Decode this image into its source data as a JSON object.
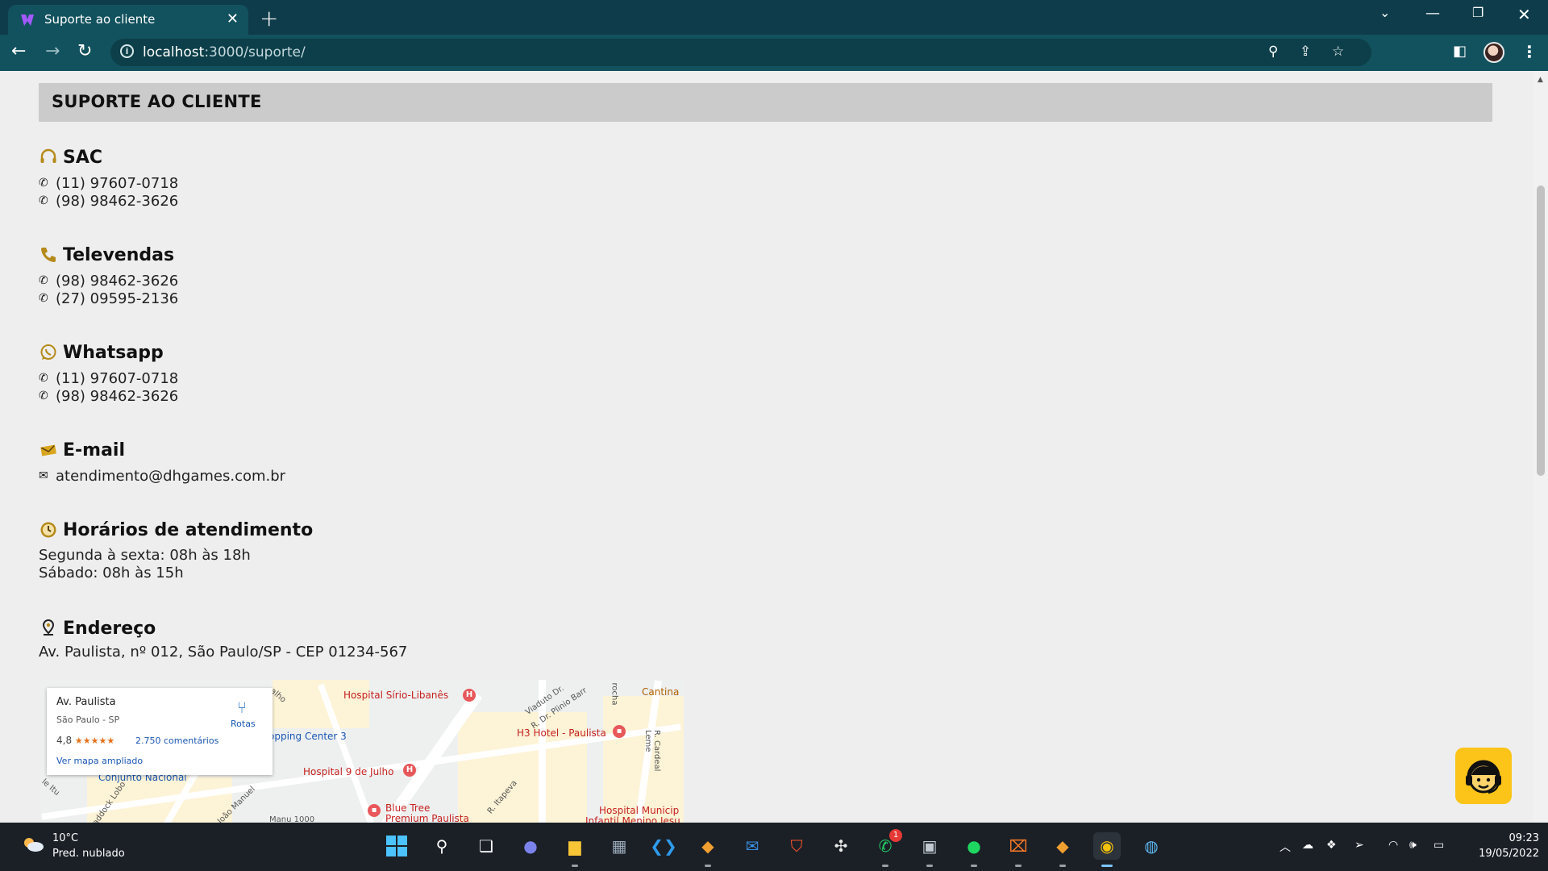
{
  "browser": {
    "tab_title": "Suporte ao cliente",
    "url_host": "localhost",
    "url_path": ":3000/suporte/",
    "accent": "#12525e",
    "frame": "#0f3c4a"
  },
  "page": {
    "header_title": "SUPORTE AO CLIENTE",
    "header_bg": "#cbcbcb",
    "sections": {
      "sac": {
        "title": "SAC",
        "icon": "headset-icon",
        "phones": [
          "(11) 97607-0718",
          "(98) 98462-3626"
        ]
      },
      "televendas": {
        "title": "Televendas",
        "icon": "phone-icon",
        "phones": [
          "(98) 98462-3626",
          "(27) 09595-2136"
        ]
      },
      "whatsapp": {
        "title": "Whatsapp",
        "icon": "whatsapp-icon",
        "phones": [
          "(11) 97607-0718",
          "(98) 98462-3626"
        ]
      },
      "email": {
        "title": "E-mail",
        "icon": "envelope-icon",
        "address": "atendimento@dhgames.com.br"
      },
      "horarios": {
        "title": "Horários de atendimento",
        "icon": "clock-icon",
        "lines": [
          "Segunda à sexta: 08h às 18h",
          "Sábado: 08h às 15h"
        ]
      },
      "endereco": {
        "title": "Endereço",
        "icon": "location-pin-icon",
        "address": "Av. Paulista, nº 012, São Paulo/SP - CEP 01234-567"
      }
    },
    "map": {
      "place_name": "Av. Paulista",
      "place_sub": "São Paulo - SP",
      "rating": "4,8",
      "stars": "★★★★★",
      "reviews": "2.750 comentários",
      "bigger_map": "Ver mapa ampliado",
      "routes": "Rotas",
      "labels": {
        "hospital_sirio": "Hospital Sírio-Libanês",
        "shopping": "opping Center 3",
        "h3_hotel": "H3 Hotel - Paulista",
        "hospital_9": "Hospital 9 de Julho",
        "conjunto": "Conjunto Nacional",
        "blue_tree": "Blue Tree",
        "blue_tree_2": "Premium Paulista",
        "cantina": "Cantina",
        "hospital_mun": "Hospital Municip",
        "hospital_mun_2": "Infantil Menino Jesu",
        "viaduto": "Viaduto Dr.",
        "plinio": "R. Dr. Plinio Barr",
        "rocha": "rocha",
        "cardeal": "R. Cardeal Leme",
        "manuel": "João Manuel",
        "itapeva": "R. Itapeva",
        "padock": "addock Lobo",
        "itu": "le Itu",
        "alho": "alho",
        "manu_1000": "Manu 1000"
      }
    },
    "support_button_color": "#fcc419"
  },
  "taskbar": {
    "temp": "10°C",
    "weather": "Pred. nublado",
    "whatsapp_badge": "1",
    "time": "09:23",
    "date": "19/05/2022"
  }
}
